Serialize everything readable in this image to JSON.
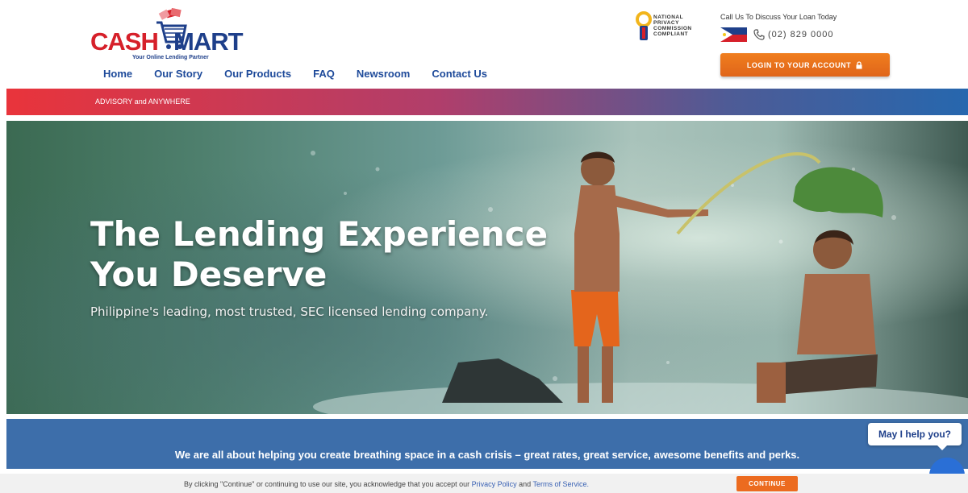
{
  "brand": {
    "name_part1": "CASH",
    "name_part2": "MART",
    "tagline": "Your Online Lending Partner"
  },
  "nav": {
    "items": [
      {
        "label": "Home"
      },
      {
        "label": "Our Story"
      },
      {
        "label": "Our Products"
      },
      {
        "label": "FAQ"
      },
      {
        "label": "Newsroom"
      },
      {
        "label": "Contact Us"
      }
    ]
  },
  "compliance": {
    "line1": "NATIONAL",
    "line2": "PRIVACY",
    "line3": "COMMISSION",
    "line4": "COMPLIANT"
  },
  "contact": {
    "label": "Call Us To Discuss Your Loan Today",
    "phone": "(02) 829 0000"
  },
  "login": {
    "label": "LOGIN TO YOUR ACCOUNT"
  },
  "advisory": {
    "text": "ADVISORY  and ANYWHERE"
  },
  "hero": {
    "title_line1": "The Lending Experience",
    "title_line2": "You Deserve",
    "subtitle": "Philippine's leading, most trusted, SEC licensed lending company."
  },
  "tagline_bar": {
    "text": "We are all about helping you create breathing space in a cash crisis – great rates, great service, awesome benefits and perks."
  },
  "chat": {
    "prompt": "May I help you?"
  },
  "cookie": {
    "text_before": "By clicking \"Continue\" or continuing to use our site, you acknowledge that you accept our",
    "privacy_link": "Privacy Policy",
    "and": "and",
    "terms_link": "Terms of Service.",
    "button": "CONTINUE"
  },
  "colors": {
    "brand_red": "#d6202a",
    "brand_blue": "#1e3f8a",
    "nav_blue": "#1e4a9a",
    "accent_orange": "#e8701d",
    "banner_blue": "#3d6eaa"
  }
}
